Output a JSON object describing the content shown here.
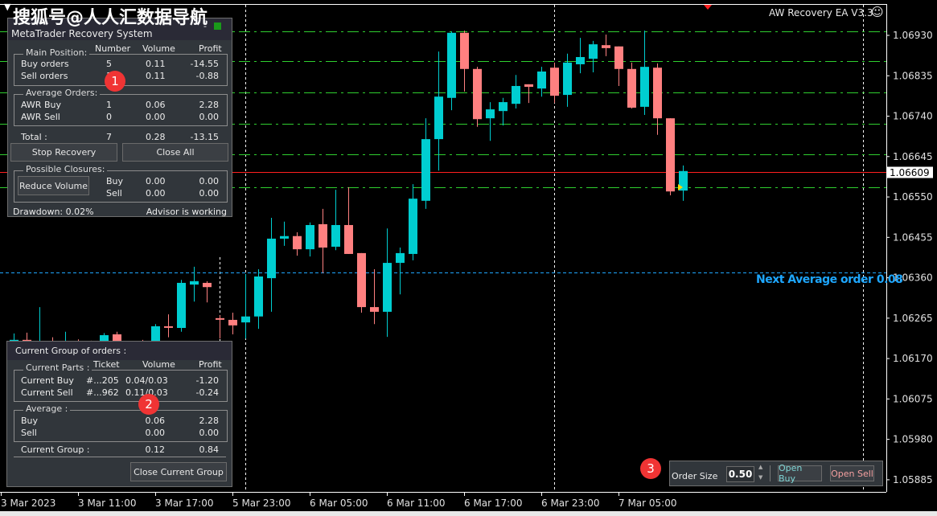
{
  "watermark": "搜狐号@人人汇数据导航",
  "ea_title": "AW Recovery EA V3.3",
  "ea_icon": "smiley-icon",
  "colors": {
    "bull": "#00ced1",
    "bear": "#ff8080",
    "level_lines": "#2fcf2f",
    "bid_line": "#ff2020",
    "next_average": "#1ea7ff",
    "panel_bg": "#31363b",
    "badge": "#f03434"
  },
  "recovery_panel": {
    "title": "MetaTrader Recovery System",
    "columns": {
      "number": "Number",
      "volume": "Volume",
      "profit": "Profit"
    },
    "main_position": {
      "legend": "Main Position:",
      "rows": [
        {
          "label": "Buy orders",
          "number": "5",
          "volume": "0.11",
          "profit": "-14.55"
        },
        {
          "label": "Sell orders",
          "number": "1",
          "volume": "0.11",
          "profit": "-0.88"
        }
      ]
    },
    "average_orders": {
      "legend": "Average Orders:",
      "rows": [
        {
          "label": "AWR Buy",
          "number": "1",
          "volume": "0.06",
          "profit": "2.28"
        },
        {
          "label": "AWR Sell",
          "number": "0",
          "volume": "0.00",
          "profit": "0.00"
        }
      ]
    },
    "total": {
      "label": "Total :",
      "number": "7",
      "volume": "0.28",
      "profit": "-13.15"
    },
    "stop_recovery": "Stop Recovery",
    "close_all": "Close All",
    "possible_closures": {
      "legend": "Possible Closures:",
      "reduce_volume": "Reduce Volume",
      "rows": [
        {
          "label": "Buy",
          "volume": "0.00",
          "profit": "0.00"
        },
        {
          "label": "Sell",
          "volume": "0.00",
          "profit": "0.00"
        }
      ]
    },
    "drawdown": "Drawdown: 0.02%",
    "status": "Advisor is working",
    "badge": "1"
  },
  "group_panel": {
    "title": "Current Group of orders :",
    "columns": {
      "ticket": "Ticket",
      "volume": "Volume",
      "profit": "Profit"
    },
    "current_parts": {
      "legend": "Current Parts :",
      "rows": [
        {
          "label": "Current Buy",
          "ticket": "#...205",
          "volume": "0.04/0.03",
          "profit": "-1.20"
        },
        {
          "label": "Current Sell",
          "ticket": "#...962",
          "volume": "0.11/0.03",
          "profit": "-0.24"
        }
      ]
    },
    "average": {
      "legend": "Average :",
      "rows": [
        {
          "label": "Buy",
          "volume": "0.06",
          "profit": "2.28"
        },
        {
          "label": "Sell",
          "volume": "0.00",
          "profit": "0.00"
        }
      ]
    },
    "current_group": {
      "label": "Current Group :",
      "volume": "0.12",
      "profit": "0.84"
    },
    "close_group": "Close Current Group",
    "badge": "2"
  },
  "order_panel": {
    "label": "Order Size",
    "value": "0.50",
    "open_buy": "Open Buy",
    "open_sell": "Open Sell",
    "badge": "3"
  },
  "next_average_label": "Next Average order 0.08",
  "chart_data": {
    "type": "candlestick",
    "price_ticks": [
      "1.06930",
      "1.06835",
      "1.06740",
      "1.06645",
      "1.06550",
      "1.06455",
      "1.06360",
      "1.06265",
      "1.06170",
      "1.06075",
      "1.05980",
      "1.05885"
    ],
    "time_ticks": [
      "3 Mar 2023",
      "3 Mar 11:00",
      "3 Mar 17:00",
      "5 Mar 23:00",
      "6 Mar 05:00",
      "6 Mar 11:00",
      "6 Mar 17:00",
      "6 Mar 23:00",
      "7 Mar 05:00"
    ],
    "current_price": "1.06609",
    "level_lines": [
      1.06939,
      1.0687,
      1.06796,
      1.06722,
      1.0665,
      1.06573
    ],
    "next_average_price": 1.06372,
    "ohlc": [
      [
        1.06212,
        1.06229,
        1.062,
        1.06214
      ],
      [
        1.06214,
        1.06231,
        1.062,
        1.06212
      ],
      [
        1.062,
        1.06291,
        1.06182,
        1.0621
      ],
      [
        1.0621,
        1.0622,
        1.06182,
        1.062
      ],
      [
        1.06195,
        1.06233,
        1.0618,
        1.06205
      ],
      [
        1.06205,
        1.06215,
        1.06185,
        1.06195
      ],
      [
        1.062,
        1.06212,
        1.0618,
        1.0619
      ],
      [
        1.0619,
        1.0623,
        1.06175,
        1.06225
      ],
      [
        1.06227,
        1.06233,
        1.06175,
        1.0619
      ],
      [
        1.0619,
        1.0621,
        1.0617,
        1.062
      ],
      [
        1.062,
        1.06214,
        1.06175,
        1.06185
      ],
      [
        1.06185,
        1.06251,
        1.0617,
        1.06246
      ],
      [
        1.06246,
        1.06274,
        1.0622,
        1.06244
      ],
      [
        1.06242,
        1.06355,
        1.06233,
        1.06348
      ],
      [
        1.06344,
        1.06386,
        1.06304,
        1.06352
      ],
      [
        1.06348,
        1.06352,
        1.06302,
        1.06338
      ],
      [
        1.06265,
        1.06272,
        1.06217,
        1.06263
      ],
      [
        1.06261,
        1.06278,
        1.06227,
        1.06248
      ],
      [
        1.06255,
        1.06369,
        1.06217,
        1.06269
      ],
      [
        1.06269,
        1.0638,
        1.0624,
        1.06363
      ],
      [
        1.06359,
        1.06501,
        1.0628,
        1.06452
      ],
      [
        1.06452,
        1.06492,
        1.06435,
        1.06458
      ],
      [
        1.06458,
        1.06467,
        1.06412,
        1.06427
      ],
      [
        1.06427,
        1.0649,
        1.0641,
        1.06484
      ],
      [
        1.06486,
        1.06522,
        1.06371,
        1.06431
      ],
      [
        1.06433,
        1.06567,
        1.06425,
        1.06484
      ],
      [
        1.06484,
        1.06573,
        1.06416,
        1.06416
      ],
      [
        1.06418,
        1.06418,
        1.06278,
        1.06291
      ],
      [
        1.06291,
        1.0638,
        1.06251,
        1.0628
      ],
      [
        1.0628,
        1.06476,
        1.06221,
        1.06395
      ],
      [
        1.06395,
        1.06431,
        1.06321,
        1.06418
      ],
      [
        1.06416,
        1.0658,
        1.06401,
        1.06546
      ],
      [
        1.06541,
        1.06735,
        1.06522,
        1.06686
      ],
      [
        1.06686,
        1.06892,
        1.06612,
        1.06786
      ],
      [
        1.06783,
        1.06939,
        1.06754,
        1.06936
      ],
      [
        1.06936,
        1.06941,
        1.06798,
        1.06851
      ],
      [
        1.06851,
        1.06856,
        1.06715,
        1.06733
      ],
      [
        1.06735,
        1.06773,
        1.06682,
        1.06756
      ],
      [
        1.06752,
        1.06783,
        1.06718,
        1.06773
      ],
      [
        1.06769,
        1.06837,
        1.06758,
        1.06811
      ],
      [
        1.06815,
        1.06815,
        1.06771,
        1.06809
      ],
      [
        1.06805,
        1.06856,
        1.06786,
        1.06845
      ],
      [
        1.06854,
        1.06866,
        1.06771,
        1.06788
      ],
      [
        1.0679,
        1.06887,
        1.06762,
        1.06866
      ],
      [
        1.06862,
        1.06924,
        1.06841,
        1.06879
      ],
      [
        1.06875,
        1.06917,
        1.06843,
        1.06909
      ],
      [
        1.06907,
        1.06932,
        1.06881,
        1.069
      ],
      [
        1.06904,
        1.06904,
        1.06811,
        1.06851
      ],
      [
        1.06851,
        1.06866,
        1.06758,
        1.0676
      ],
      [
        1.06762,
        1.06941,
        1.06743,
        1.06856
      ],
      [
        1.06854,
        1.06864,
        1.06696,
        1.06735
      ],
      [
        1.06735,
        1.06735,
        1.06554,
        1.06563
      ],
      [
        1.06565,
        1.06624,
        1.06541,
        1.06611
      ]
    ]
  }
}
